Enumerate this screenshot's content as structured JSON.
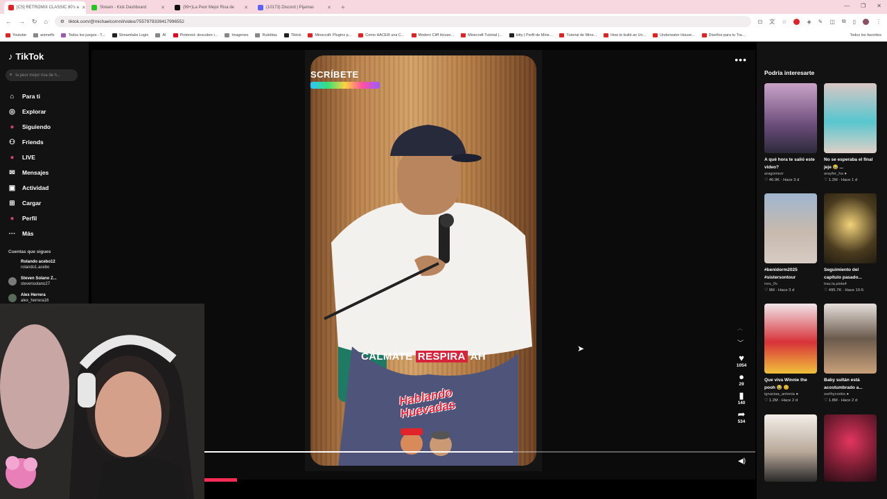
{
  "browser": {
    "tabs": [
      {
        "title": "[CS] RETROMIX CLASSIC 80's a",
        "color": "#e02424",
        "active": true
      },
      {
        "title": "Stream - Kick Dashboard",
        "color": "#25c425",
        "active": false
      },
      {
        "title": "(99+)La Peor Mejor Risa de",
        "color": "#111111",
        "active": false
      },
      {
        "title": "(10173) Discord | Pijamas",
        "color": "#5865f2",
        "active": false
      }
    ],
    "url": "tiktok.com/@michaelcornnil/video/7557979339417996552",
    "bookmarks": [
      "Youtube",
      "animeflv",
      "Todos los juegos - T...",
      "Streamlabs Login",
      "AI",
      "Pinterest: descubre i...",
      "Imagenes",
      "Ruletitas",
      "Tiktok",
      "Minecraft: Plugins p...",
      "Como HACER una C...",
      "Modern Cliff House...",
      "Minecraft Tutorial |...",
      "kitty | Perfil de Mine...",
      "Tutorial de Mine...",
      "How to build an Un...",
      "Underwater House...",
      "Diseños para tu Tra..."
    ],
    "bookmarks_right": "Todos los favoritos"
  },
  "sidebar": {
    "logo": "TikTok",
    "search_placeholder": "la peor mejor risa de h...",
    "items": [
      {
        "label": "Para ti",
        "icon": "home-icon",
        "glyph": "⌂"
      },
      {
        "label": "Explorar",
        "icon": "compass-icon",
        "glyph": "◎"
      },
      {
        "label": "Siguiendo",
        "icon": "following-icon",
        "glyph": "●"
      },
      {
        "label": "Friends",
        "icon": "friends-icon",
        "glyph": "⚇"
      },
      {
        "label": "LIVE",
        "icon": "live-icon",
        "glyph": "●"
      },
      {
        "label": "Mensajes",
        "icon": "messages-icon",
        "glyph": "✉"
      },
      {
        "label": "Actividad",
        "icon": "activity-icon",
        "glyph": "▣"
      },
      {
        "label": "Cargar",
        "icon": "upload-icon",
        "glyph": "⊞"
      },
      {
        "label": "Perfil",
        "icon": "profile-icon",
        "glyph": "●"
      },
      {
        "label": "Más",
        "icon": "more-icon",
        "glyph": "···"
      }
    ],
    "following_header": "Cuentas que sigues",
    "following": [
      {
        "name": "Rolando acebo12",
        "user": "rolando1.acebo"
      },
      {
        "name": "Steven Solano Z...",
        "user": "stevensolano27"
      },
      {
        "name": "Alex Herrera",
        "user": "alex_herrera16"
      }
    ]
  },
  "video": {
    "banner_text": "SCRÍBETE",
    "caption_prefix": "CÁLMATE",
    "caption_highlight": "RESPIRA",
    "caption_suffix": "AH",
    "logo_text": "Hablando Huevadas",
    "progress": 0.56,
    "actions": [
      {
        "icon": "heart-icon",
        "glyph": "♥",
        "count": "1054"
      },
      {
        "icon": "comment-icon",
        "glyph": "●",
        "count": "29"
      },
      {
        "icon": "bookmark-icon",
        "glyph": "▮",
        "count": "140"
      },
      {
        "icon": "share-icon",
        "glyph": "➦",
        "count": "534"
      }
    ]
  },
  "recommendations": {
    "title": "Podría interesarte",
    "cards": [
      {
        "title": "A qué hora te salió este video?",
        "author": "aragomezr",
        "stats": "♡ 46.9K · Hace 3 d"
      },
      {
        "title": "No se esperaba el final jeje 😂 ...",
        "author": "arayfer_ha ●",
        "stats": "♡ 1.2M · Hace 1 d"
      },
      {
        "title": "#benidorm2025 #sistersontour",
        "author": "mrs_0v",
        "stats": "♡ 9M · Hace 3 d"
      },
      {
        "title": "Seguimiento del capítulo pasado...",
        "author": "tras.la.pista4",
        "stats": "♡ 495.7K · Hace 10-5"
      },
      {
        "title": "Que viva Winnie the pooh 😂 😊",
        "author": "ignaciaa_antonia ●",
        "stats": "♡ 1.2M · Hace 2 d"
      },
      {
        "title": "Baby sultán está acostumbrado a...",
        "author": "surthycooks ●",
        "stats": "♡ 1.8M · Hace 2 d"
      },
      {
        "title": "",
        "author": "",
        "stats": ""
      },
      {
        "title": "",
        "author": "",
        "stats": ""
      }
    ]
  }
}
